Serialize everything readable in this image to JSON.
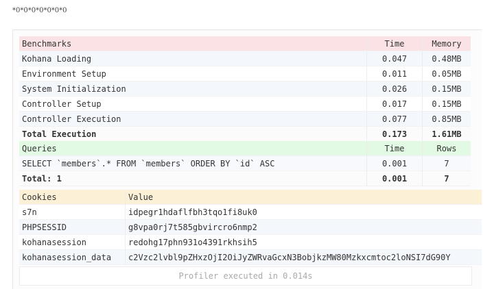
{
  "page_output": "*0*0*0*0*0*0*0",
  "benchmarks": {
    "headers": [
      "Benchmarks",
      "Time",
      "Memory"
    ],
    "rows": [
      {
        "name": "Kohana Loading",
        "time": "0.047",
        "memory": "0.48MB"
      },
      {
        "name": "Environment Setup",
        "time": "0.011",
        "memory": "0.05MB"
      },
      {
        "name": "System Initialization",
        "time": "0.026",
        "memory": "0.15MB"
      },
      {
        "name": "Controller Setup",
        "time": "0.017",
        "memory": "0.15MB"
      },
      {
        "name": "Controller Execution",
        "time": "0.077",
        "memory": "0.85MB"
      }
    ],
    "total": {
      "name": "Total Execution",
      "time": "0.173",
      "memory": "1.61MB"
    }
  },
  "queries": {
    "headers": [
      "Queries",
      "Time",
      "Rows"
    ],
    "rows": [
      {
        "sql": "SELECT `members`.* FROM `members` ORDER BY `id` ASC",
        "time": "0.001",
        "rows": "7"
      }
    ],
    "total": {
      "label": "Total: 1",
      "time": "0.001",
      "rows": "7"
    }
  },
  "cookies": {
    "headers": [
      "Cookies",
      "Value"
    ],
    "rows": [
      {
        "key": "s7n",
        "value": "idpegr1hdaflfbh3tqo1fi8uk0"
      },
      {
        "key": "PHPSESSID",
        "value": "g8vpa0rj7t585gbvircro6nmp2"
      },
      {
        "key": "kohanasession",
        "value": "redohg17phn931o4391rkhsih5"
      },
      {
        "key": "kohanasession_data",
        "value": "c2Vzc2lvbl9pZHxzOjI2OiJyZWRvaGcxN3BobjkzMW80Mzkxcmtoc2loNSI7dG90Y"
      }
    ]
  },
  "footer": "Profiler executed in 0.014s"
}
